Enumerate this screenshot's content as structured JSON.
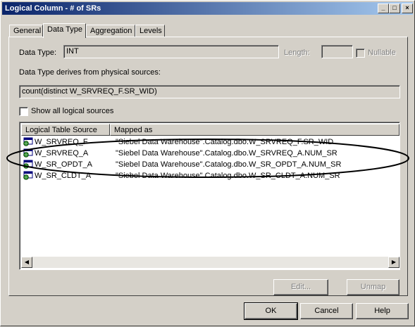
{
  "window": {
    "title": "Logical Column - # of SRs",
    "minimize": "_",
    "maximize": "□",
    "close": "×"
  },
  "tabs": [
    {
      "label": "General",
      "active": false
    },
    {
      "label": "Data Type",
      "active": true
    },
    {
      "label": "Aggregation",
      "active": false
    },
    {
      "label": "Levels",
      "active": false
    }
  ],
  "datatype": {
    "label": "Data Type:",
    "value": "INT",
    "length_label": "Length:",
    "length_value": "",
    "nullable_label": "Nullable",
    "nullable_checked": false
  },
  "derives": {
    "label": "Data Type derives from physical sources:",
    "expression": "count(distinct W_SRVREQ_F.SR_WID)"
  },
  "show_all": {
    "label": "Show all logical sources",
    "checked": false
  },
  "list": {
    "columns": [
      "Logical Table Source",
      "Mapped as"
    ],
    "rows": [
      {
        "source": "W_SRVREQ_F",
        "mapped": "\"Siebel Data Warehouse\".Catalog.dbo.W_SRVREQ_F.SR_WID"
      },
      {
        "source": "W_SRVREQ_A",
        "mapped": "\"Siebel Data Warehouse\".Catalog.dbo.W_SRVREQ_A.NUM_SR"
      },
      {
        "source": "W_SR_OPDT_A",
        "mapped": "\"Siebel Data Warehouse\".Catalog.dbo.W_SR_OPDT_A.NUM_SR"
      },
      {
        "source": "W_SR_CLDT_A",
        "mapped": "\"Siebel Data Warehouse\".Catalog.dbo.W_SR_CLDT_A.NUM_SR"
      }
    ],
    "row_icon": "table-source-icon"
  },
  "actions": {
    "edit": "Edit...",
    "unmap": "Unmap"
  },
  "footer": {
    "ok": "OK",
    "cancel": "Cancel",
    "help": "Help"
  },
  "colors": {
    "face": "#d4d0c8",
    "title_start": "#0a246a",
    "title_end": "#a6caf0"
  }
}
